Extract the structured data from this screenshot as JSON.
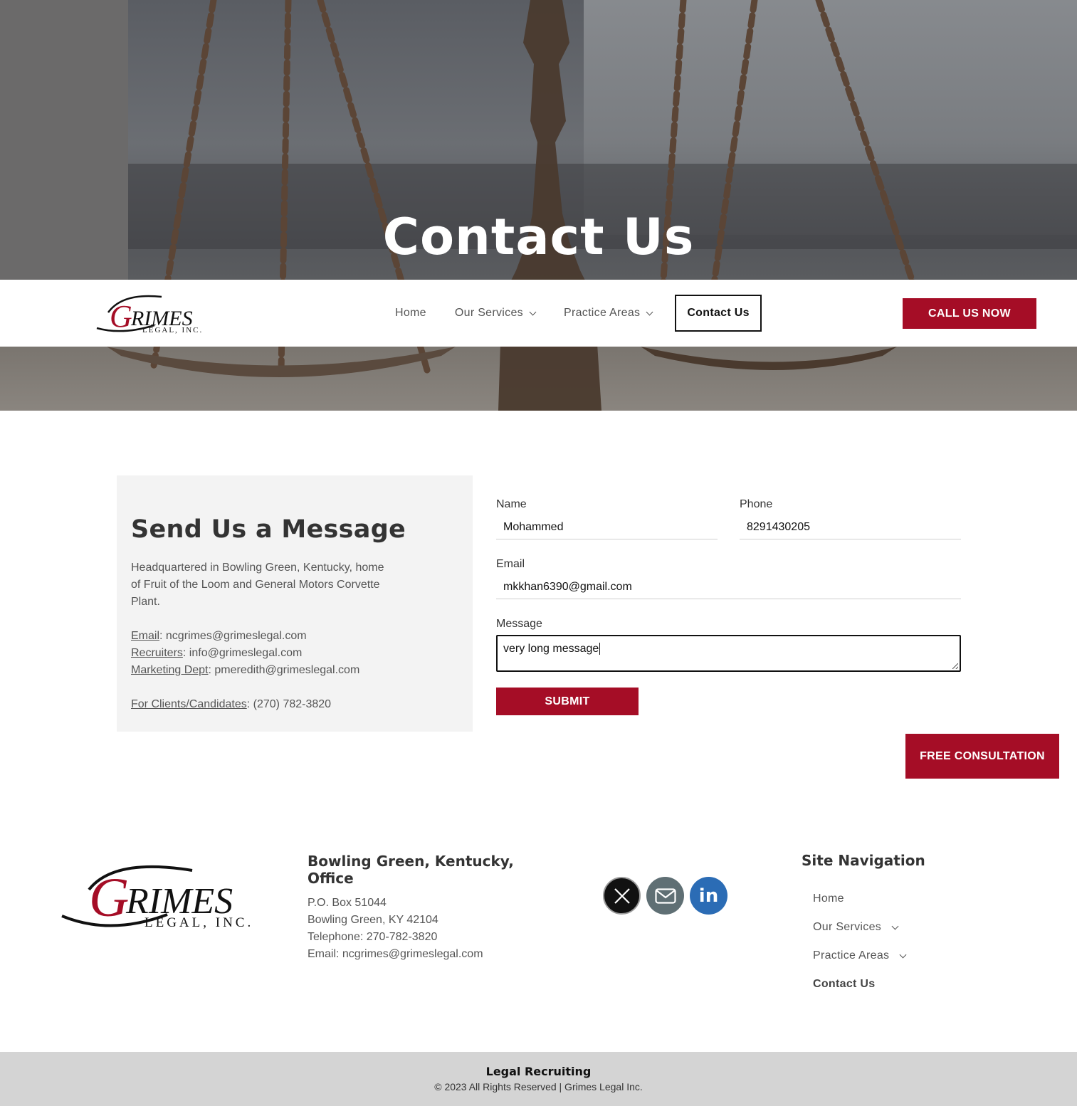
{
  "hero": {
    "title": "Contact Us"
  },
  "brand": {
    "name_big": "RIMES",
    "letter": "G",
    "sub": "LEGAL, INC.",
    "accent": "#a50d26"
  },
  "nav": {
    "items": [
      {
        "label": "Home"
      },
      {
        "label": "Our Services"
      },
      {
        "label": "Practice Areas"
      },
      {
        "label": "Contact Us"
      }
    ],
    "call_button": "CALL US NOW"
  },
  "info": {
    "heading": "Send Us a Message",
    "description": "Headquartered in Bowling Green, Kentucky, home of Fruit of the Loom and General Motors Corvette Plant.",
    "email_label": "Email",
    "email_value": ": ncgrimes@grimeslegal.com",
    "recruiters_label": "Recruiters",
    "recruiters_value": ": info@grimeslegal.com",
    "marketing_label": "Marketing Dept",
    "marketing_value": ": pmeredith@grimeslegal.com",
    "clients_label": "For Clients/Candidates",
    "clients_value": ": (270) 782-3820"
  },
  "form": {
    "name_label": "Name",
    "name_value": "Mohammed",
    "phone_label": "Phone",
    "phone_value": "8291430205",
    "email_label": "Email",
    "email_value": "mkkhan6390@gmail.com",
    "message_label": "Message",
    "message_value": "very long message",
    "submit_label": "SUBMIT"
  },
  "free_consultation": "FREE CONSULTATION",
  "footer": {
    "office_heading": "Bowling Green, Kentucky, Office",
    "po_box": "P.O. Box 51044",
    "city": "Bowling Green, KY 42104",
    "telephone": "Telephone: 270-782-3820",
    "email": "Email:  ncgrimes@grimeslegal.com",
    "social_icons": [
      "x-icon",
      "mail-icon",
      "linkedin-icon"
    ],
    "linkedin_text": "in",
    "site_nav_heading": "Site Navigation",
    "site_nav": [
      {
        "label": "Home"
      },
      {
        "label": "Our Services"
      },
      {
        "label": "Practice Areas"
      },
      {
        "label": "Contact Us"
      }
    ]
  },
  "bottom_bar": {
    "title": "Legal Recruiting",
    "copyright": "© 2023 All Rights Reserved | Grimes Legal Inc."
  }
}
